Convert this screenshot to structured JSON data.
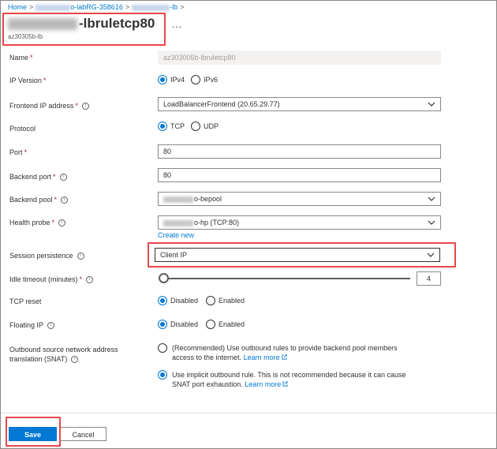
{
  "breadcrumb": {
    "home": "Home",
    "sep": ">",
    "rg_suffix": "o-labRG-358616",
    "lb_suffix": "-lb"
  },
  "header": {
    "title_suffix": "-lbruletcp80",
    "subtitle": "az30305b-lb",
    "more": "..."
  },
  "form": {
    "name": {
      "label": "Name",
      "value": "az303005b-lbruletcp80"
    },
    "ip_version": {
      "label": "IP Version",
      "options": [
        "IPv4",
        "IPv6"
      ],
      "selected": "IPv4"
    },
    "frontend_ip": {
      "label": "Frontend IP address",
      "value": "LoadBalancerFrontend (20.65.29.77)"
    },
    "protocol": {
      "label": "Protocol",
      "options": [
        "TCP",
        "UDP"
      ],
      "selected": "TCP"
    },
    "port": {
      "label": "Port",
      "value": "80"
    },
    "backend_port": {
      "label": "Backend port",
      "value": "80"
    },
    "backend_pool": {
      "label": "Backend pool",
      "value_suffix": "o-bepool"
    },
    "health_probe": {
      "label": "Health probe",
      "value_suffix": "o-hp (TCP:80)",
      "create_new": "Create new"
    },
    "session_persistence": {
      "label": "Session persistence",
      "value": "Client IP"
    },
    "idle_timeout": {
      "label": "Idle timeout (minutes)",
      "value": "4"
    },
    "tcp_reset": {
      "label": "TCP reset",
      "options": [
        "Disabled",
        "Enabled"
      ],
      "selected": "Disabled"
    },
    "floating_ip": {
      "label": "Floating IP",
      "options": [
        "Disabled",
        "Enabled"
      ],
      "selected": "Disabled"
    },
    "snat": {
      "label_line1": "Outbound source network address",
      "label_line2": "translation (SNAT)",
      "option1_line1": "(Recommended) Use outbound rules to provide backend pool members",
      "option1_line2": "access to the internet.",
      "option1_link": "Learn more",
      "option2_line1": "Use implicit outbound rule. This is not recommended because it can cause",
      "option2_line2": "SNAT port exhaustion.",
      "option2_link": "Learn more",
      "selected": 2
    },
    "required_mark": "*",
    "info_glyph": "i"
  },
  "footer": {
    "save_label": "Save",
    "cancel_label": "Cancel"
  },
  "colors": {
    "accent": "#0078d4",
    "highlight": "#e8474b",
    "required": "#a4262c"
  },
  "icons": {
    "dropdown": "chevron-down-icon",
    "external_link": "external-link-icon",
    "info": "info-icon"
  }
}
